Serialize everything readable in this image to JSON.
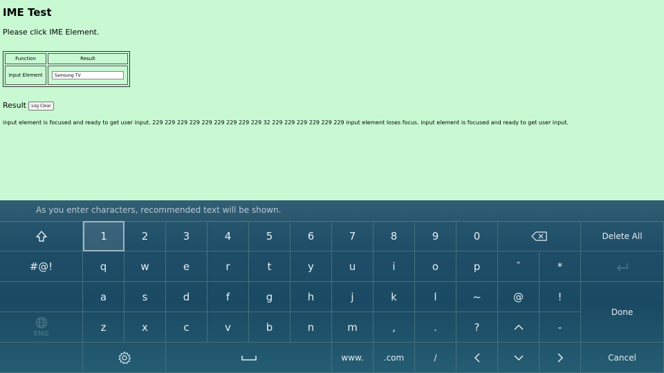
{
  "page": {
    "title": "IME Test",
    "instruction": "Please click IME Element.",
    "table": {
      "header_function": "Function",
      "header_result": "Result",
      "row_label": "Input Element",
      "input_value": "Samsung TV"
    },
    "result_label": "Result",
    "log_clear_label": "Log Clear",
    "log_text": "input element is focused and ready to get user input. 229 229 229 229 229 229 229 229 229 32 229 229 229 229 229 229 input element loses focus. input element is focused and ready to get user input."
  },
  "keyboard": {
    "suggestion_hint": "As you enter characters, recommended text will be shown.",
    "row1": [
      "1",
      "2",
      "3",
      "4",
      "5",
      "6",
      "7",
      "8",
      "9",
      "0"
    ],
    "row2": [
      "q",
      "w",
      "e",
      "r",
      "t",
      "y",
      "u",
      "i",
      "o",
      "p",
      "ˆ",
      "*"
    ],
    "row3": [
      "a",
      "s",
      "d",
      "f",
      "g",
      "h",
      "j",
      "k",
      "l",
      "~",
      "@",
      "!"
    ],
    "row4": [
      "z",
      "x",
      "c",
      "v",
      "b",
      "n",
      "m",
      ",",
      ".",
      "?",
      "-"
    ],
    "symbols_label": "#@!",
    "delete_all_label": "Delete All",
    "done_label": "Done",
    "cancel_label": "Cancel",
    "www_label": "www.",
    "com_label": ".com",
    "slash_label": "/",
    "language_label": "ENG",
    "focused_key": "1"
  }
}
